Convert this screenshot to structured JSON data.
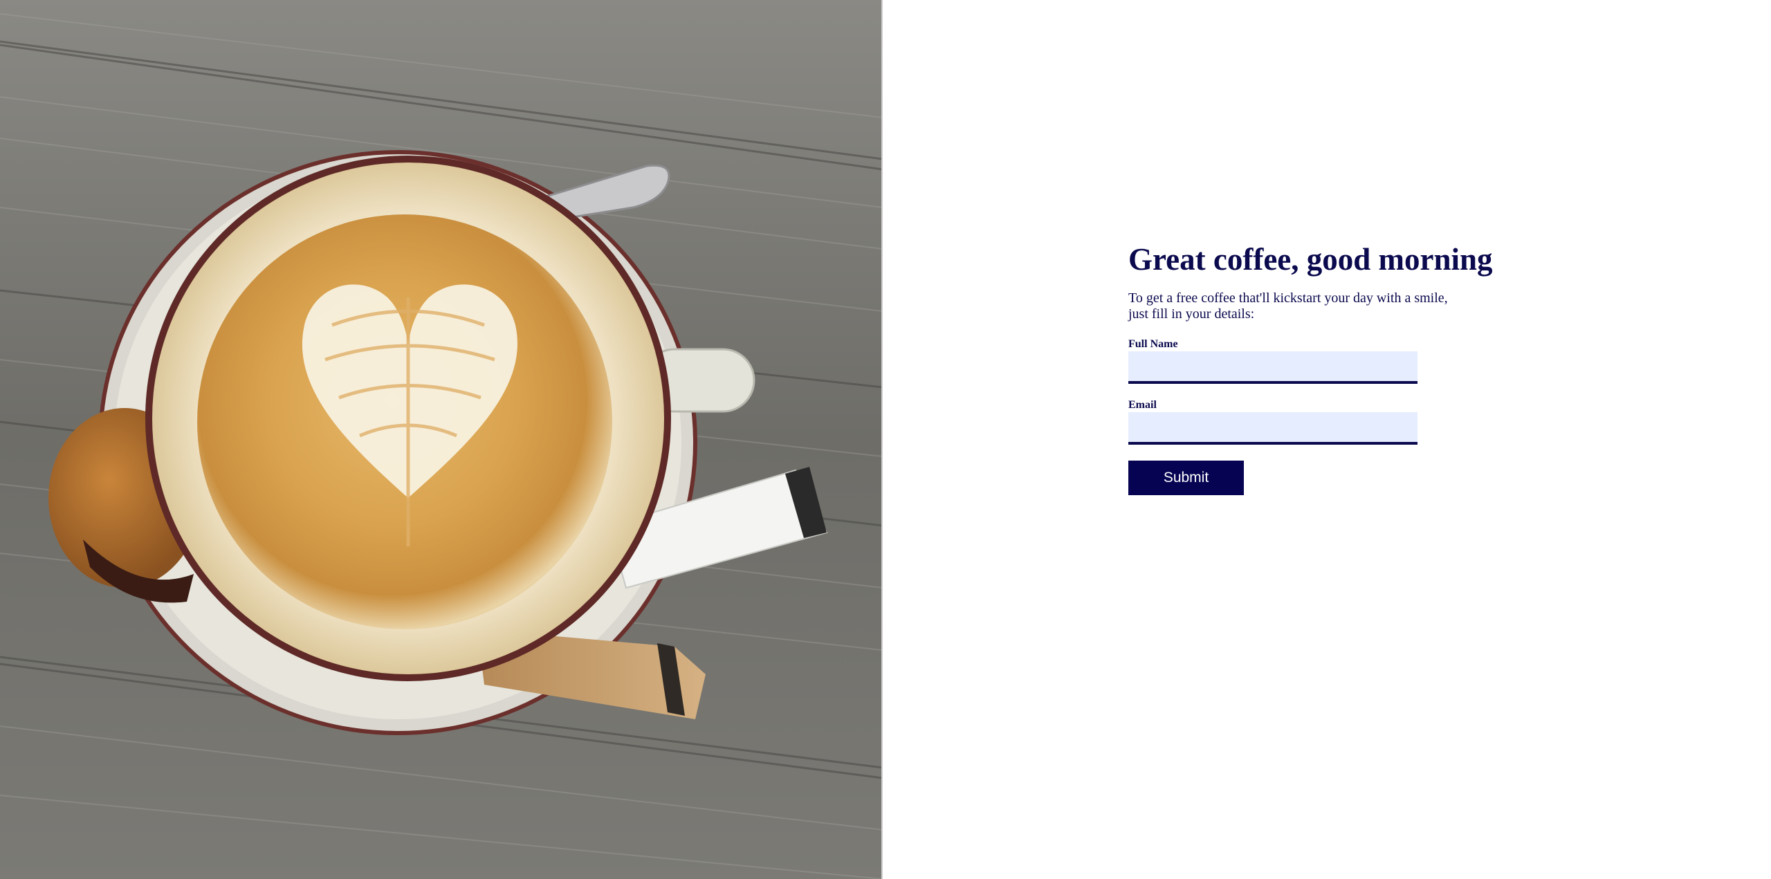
{
  "photo": {
    "alt": "Latte art coffee cup on a weathered wooden table"
  },
  "form": {
    "title": "Great coffee, good morning",
    "intro": "To get a free coffee that'll kickstart your day with a smile, just fill in your details:",
    "full_name_label": "Full Name",
    "full_name_value": "",
    "email_label": "Email",
    "email_value": "",
    "submit_label": "Submit"
  },
  "colors": {
    "navy": "#0b0a4e",
    "button": "#060452",
    "input_bg": "#e5edfe",
    "page_bg": "#ffffff"
  }
}
